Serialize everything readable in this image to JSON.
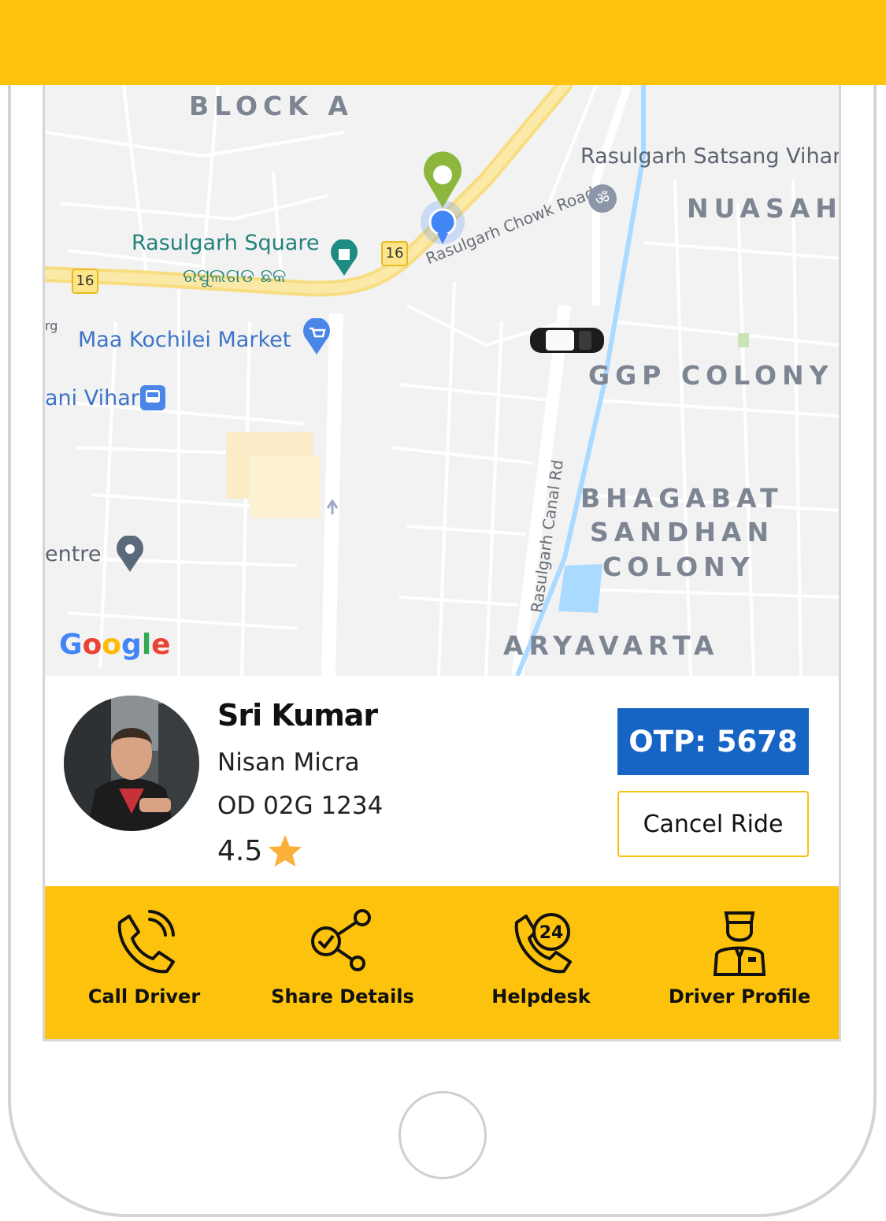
{
  "map": {
    "areas": [
      "BLOCK A",
      "NUASAH",
      "GGP COLONY",
      "BHAGABAT",
      "SANDHAN",
      "COLONY",
      "ARYAVARTA"
    ],
    "places": {
      "satsang": "Rasulgarh Satsang Vihar",
      "square": "Rasulgarh Square",
      "square_local": "ରସୁଲଗଡ ଛକ",
      "market": "Maa Kochilei Market",
      "vihar": "ani Vihar",
      "centre": "entre",
      "edge_fragment": "rg"
    },
    "roads": {
      "chowk": "Rasulgarh Chowk Road",
      "canal": "Rasulgarh Canal Rd",
      "highway_number": "16"
    },
    "attribution": [
      "G",
      "o",
      "o",
      "g",
      "l",
      "e"
    ],
    "colors": {
      "pickup_pin": "#8cb63c",
      "current_location": "#4285f4",
      "water": "#aadaff"
    }
  },
  "driver": {
    "name": "Sri Kumar",
    "car": "Nisan Micra",
    "plate": "OD 02G 1234",
    "rating": "4.5"
  },
  "otp": "OTP: 5678",
  "cancel_label": "Cancel Ride",
  "actions": [
    {
      "label": "Call Driver",
      "icon": "phone-call-icon"
    },
    {
      "label": "Share Details",
      "icon": "share-icon"
    },
    {
      "label": "Helpdesk",
      "icon": "support-24-icon"
    },
    {
      "label": "Driver Profile",
      "icon": "chauffeur-icon"
    }
  ],
  "colors": {
    "brand": "#fdc20c",
    "otp_bg": "#1664c4",
    "star": "#fbb03b"
  }
}
